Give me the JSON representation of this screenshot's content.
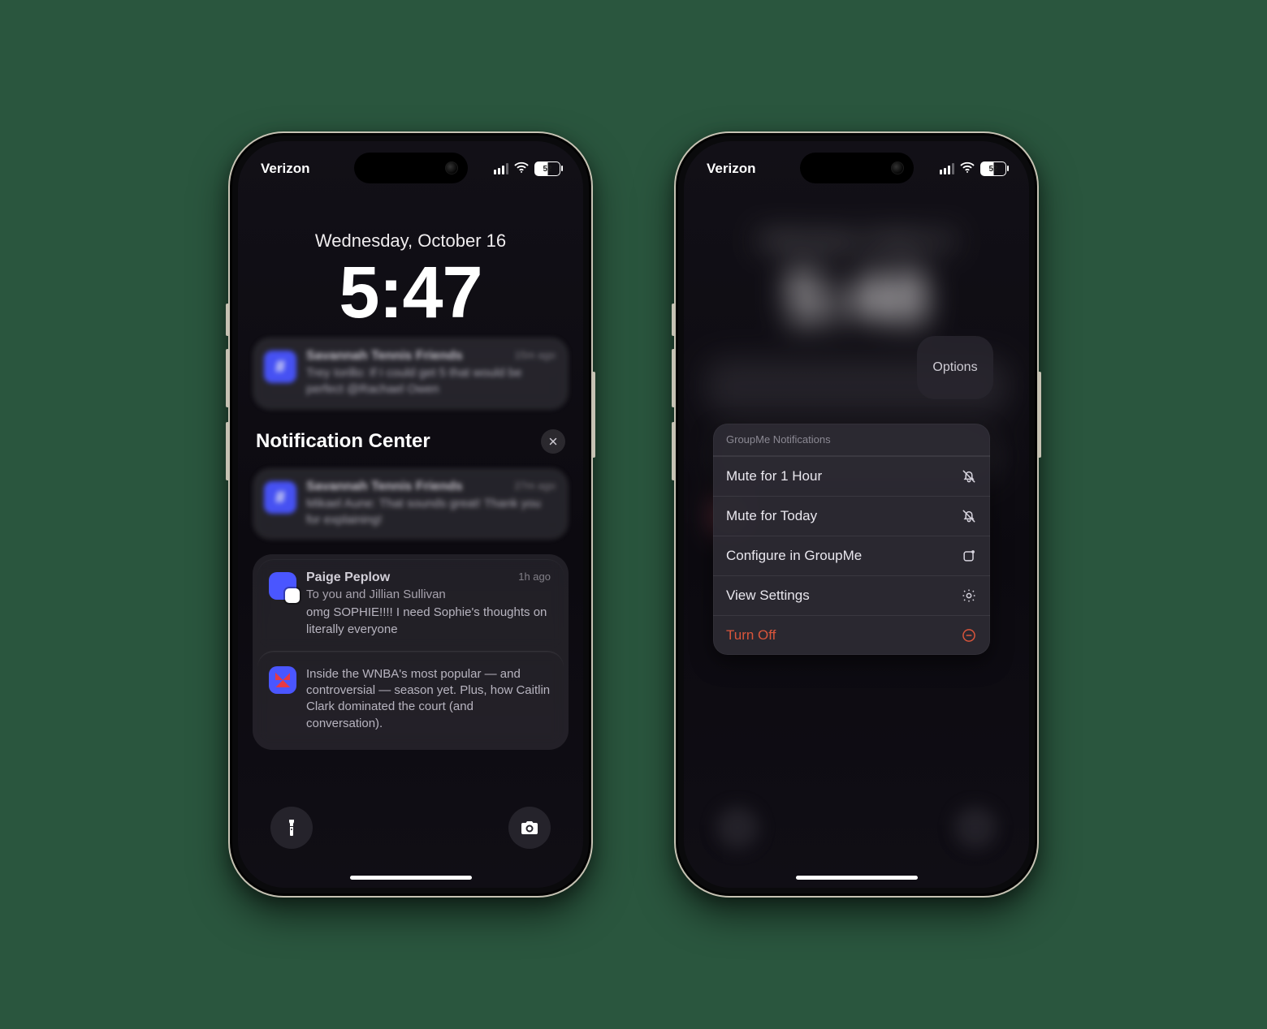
{
  "status": {
    "carrier": "Verizon",
    "battery": "52"
  },
  "phone1": {
    "date": "Wednesday, October 16",
    "time": "5:47",
    "section": "Notification Center",
    "notifications": {
      "top": {
        "title": "Savannah Tennis Friends",
        "time": "15m ago",
        "body": "Trey Iorillo: If I could get 5 that would be perfect @Rachael Owen"
      },
      "older1": {
        "title": "Savannah Tennis Friends",
        "time": "27m ago",
        "body": "Mikael Aune: That sounds great! Thank you for explaining!"
      },
      "older2": {
        "title": "Paige Peplow",
        "time": "1h ago",
        "line1": "To you and Jillian Sullivan",
        "body": "omg SOPHIE!!!! I need Sophie's thoughts on literally everyone"
      },
      "older3": {
        "body": "Inside the WNBA's most popular — and controversial — season yet. Plus, how Caitlin Clark dominated the court (and conversation)."
      }
    }
  },
  "phone2": {
    "date": "Wednesday, October 16",
    "time": "5:48",
    "options_label": "Options",
    "sheet": {
      "header": "GroupMe Notifications",
      "mute_hour": "Mute for 1 Hour",
      "mute_today": "Mute for Today",
      "configure": "Configure in GroupMe",
      "view_settings": "View Settings",
      "turn_off": "Turn Off"
    }
  }
}
